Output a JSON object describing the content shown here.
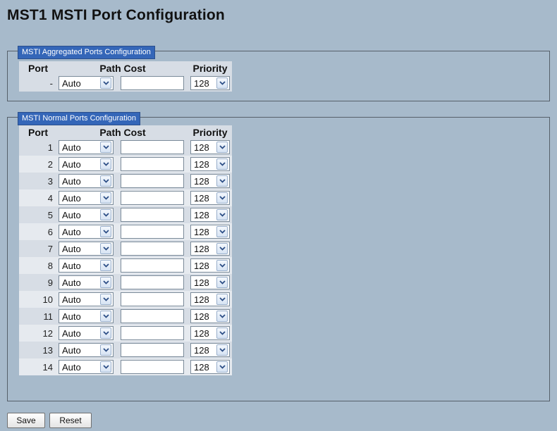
{
  "page": {
    "title": "MST1 MSTI Port Configuration"
  },
  "aggregated": {
    "legend": "MSTI Aggregated Ports Configuration",
    "headers": {
      "port": "Port",
      "path_cost": "Path Cost",
      "priority": "Priority"
    },
    "rows": [
      {
        "port": "-",
        "path_cost_mode": "Auto",
        "path_cost_value": "",
        "priority": "128"
      }
    ]
  },
  "normal": {
    "legend": "MSTI Normal Ports Configuration",
    "headers": {
      "port": "Port",
      "path_cost": "Path Cost",
      "priority": "Priority"
    },
    "rows": [
      {
        "port": "1",
        "path_cost_mode": "Auto",
        "path_cost_value": "",
        "priority": "128"
      },
      {
        "port": "2",
        "path_cost_mode": "Auto",
        "path_cost_value": "",
        "priority": "128"
      },
      {
        "port": "3",
        "path_cost_mode": "Auto",
        "path_cost_value": "",
        "priority": "128"
      },
      {
        "port": "4",
        "path_cost_mode": "Auto",
        "path_cost_value": "",
        "priority": "128"
      },
      {
        "port": "5",
        "path_cost_mode": "Auto",
        "path_cost_value": "",
        "priority": "128"
      },
      {
        "port": "6",
        "path_cost_mode": "Auto",
        "path_cost_value": "",
        "priority": "128"
      },
      {
        "port": "7",
        "path_cost_mode": "Auto",
        "path_cost_value": "",
        "priority": "128"
      },
      {
        "port": "8",
        "path_cost_mode": "Auto",
        "path_cost_value": "",
        "priority": "128"
      },
      {
        "port": "9",
        "path_cost_mode": "Auto",
        "path_cost_value": "",
        "priority": "128"
      },
      {
        "port": "10",
        "path_cost_mode": "Auto",
        "path_cost_value": "",
        "priority": "128"
      },
      {
        "port": "11",
        "path_cost_mode": "Auto",
        "path_cost_value": "",
        "priority": "128"
      },
      {
        "port": "12",
        "path_cost_mode": "Auto",
        "path_cost_value": "",
        "priority": "128"
      },
      {
        "port": "13",
        "path_cost_mode": "Auto",
        "path_cost_value": "",
        "priority": "128"
      },
      {
        "port": "14",
        "path_cost_mode": "Auto",
        "path_cost_value": "",
        "priority": "128"
      }
    ]
  },
  "buttons": {
    "save": "Save",
    "reset": "Reset"
  },
  "icons": {
    "dropdown": "chevron-down-icon"
  },
  "colors": {
    "background": "#a7bacb",
    "legend": "#3466b8",
    "table_cell": "#d7dde5"
  }
}
